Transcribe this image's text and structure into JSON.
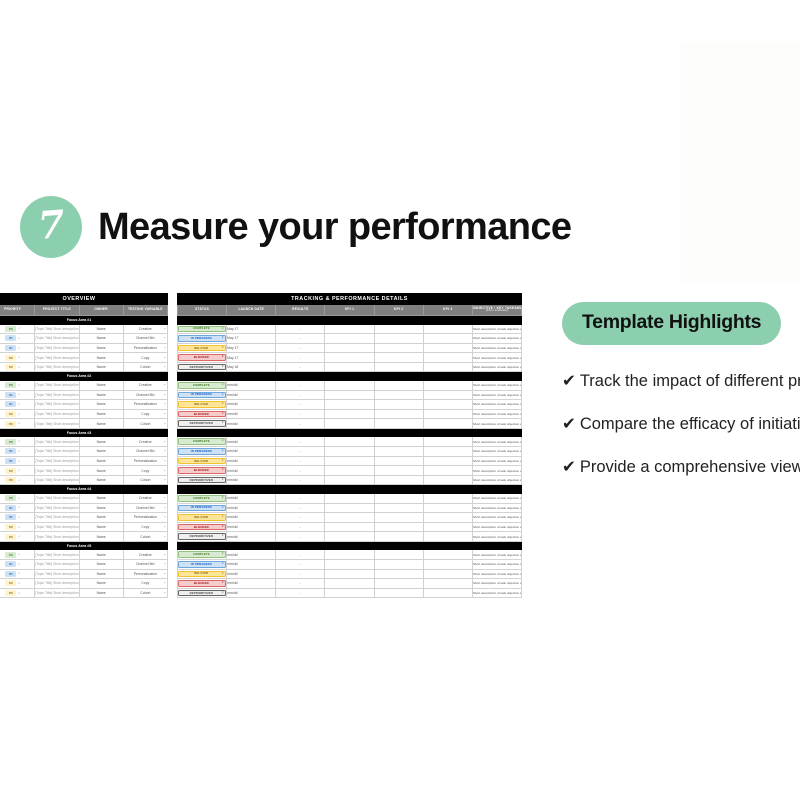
{
  "slide": {
    "step_number": "7",
    "title": "Measure your performance"
  },
  "spreadsheet": {
    "sections": {
      "overview_title": "OVERVIEW",
      "tracking_title": "TRACKING & PERFORMANCE DETAILS"
    },
    "overview_headers": [
      "PRIORITY",
      "PROJECT TITLE",
      "OWNER",
      "TESTING VARIABLE"
    ],
    "tracking_headers": [
      "STATUS",
      "LAUNCH DATE",
      "RESULTS",
      "KPI 1",
      "KPI 2",
      "KPI 3"
    ],
    "objective_header": "OBJECTIVE / KEY TAKEAWAY",
    "objective_subheader": "(when available)",
    "focus_areas": [
      "Focus Area #1",
      "Focus Area #2",
      "Focus Area #3",
      "Focus Area #4",
      "Focus Area #5"
    ],
    "row_template": {
      "project_title": "[Topic Title] Short description",
      "owner": "Name",
      "objective": "Short description of task objective and/or key takeaway/notes once completes",
      "results_placeholder": "-",
      "date_placeholder": "mm/dd"
    },
    "testing_variables": [
      "Creative",
      "Channel Mix",
      "Personalization",
      "Copy",
      "Cohort"
    ],
    "priorities": [
      "P0",
      "P1",
      "P1",
      "P2",
      "P2"
    ],
    "statuses": [
      "COMPLETE",
      "IN PROGRESS",
      "DELAYED",
      "BLOCKED",
      "DEPRIORITIZED"
    ],
    "first_block_dates": [
      "May 17",
      "May 17",
      "May 17",
      "May 17",
      "May 18"
    ],
    "colors": {
      "band_title_bg": "#000000",
      "band_head_bg": "#808080",
      "complete": "#d9ead3",
      "in_progress": "#cfe2f3",
      "delayed": "#ffe599",
      "blocked": "#f4cccc",
      "deprioritized": "#efefef"
    }
  },
  "highlights": {
    "pill_label": "Template Highlights",
    "check_glyph": "✔",
    "items": [
      "Track the impact of different project milestones",
      "Compare the efficacy of initiatives against each other",
      "Provide a comprehensive view into project impact"
    ]
  },
  "theme": {
    "accent_green": "#8ccfae",
    "text_dark": "#111111"
  }
}
